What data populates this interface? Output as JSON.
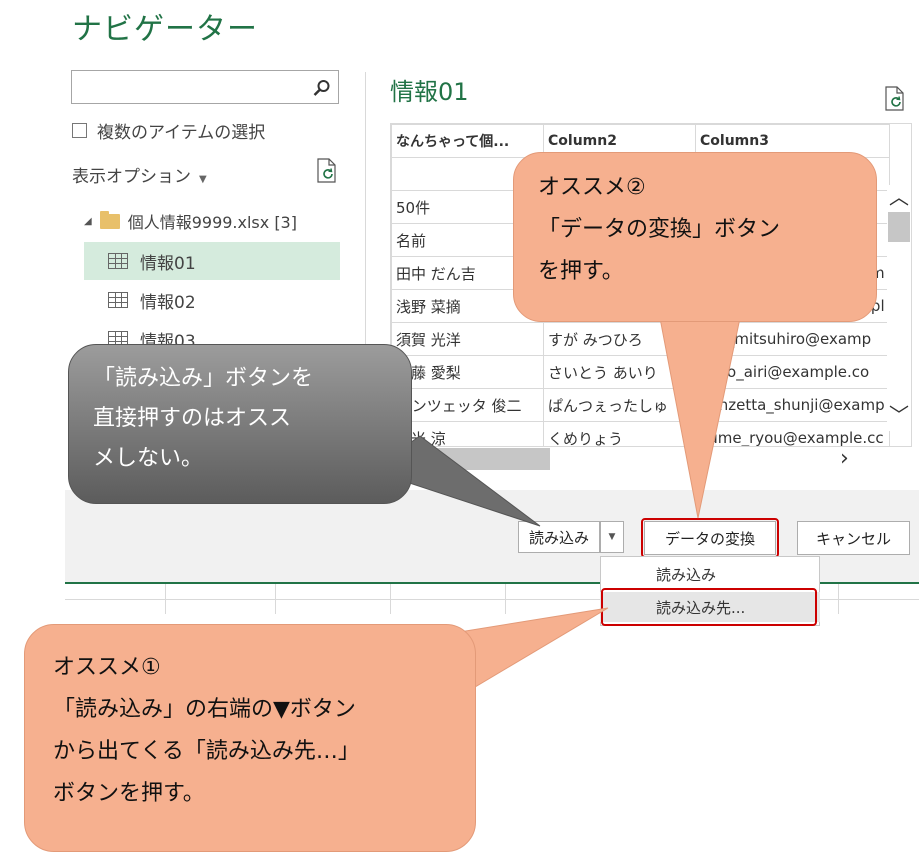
{
  "window": {
    "title": "ナビゲーター"
  },
  "left_pane": {
    "search": {
      "value": "",
      "placeholder": ""
    },
    "multi_select_label": "複数のアイテムの選択",
    "display_options_label": "表示オプション",
    "tree": {
      "root_label": "個人情報9999.xlsx [3]",
      "items": [
        {
          "label": "情報01",
          "selected": true
        },
        {
          "label": "情報02",
          "selected": false
        },
        {
          "label": "情報03",
          "selected": false
        }
      ]
    }
  },
  "preview": {
    "title": "情報01",
    "columns": [
      "なんちゃって個...",
      "Column2",
      "Column3"
    ],
    "rows": [
      [
        "",
        "",
        ""
      ],
      [
        "50件",
        "",
        ""
      ],
      [
        "名前",
        "",
        ""
      ],
      [
        "田中 だん吉",
        "",
        "m"
      ],
      [
        "浅野 菜摘",
        "",
        "pl"
      ],
      [
        "須賀 光洋",
        "すが みつひろ",
        "sug_mitsuhiro@examp"
      ],
      [
        "斎藤 愛梨",
        "さいとう あいり",
        "saito_airi@example.co"
      ],
      [
        "パンツェッタ 俊二",
        "ぱんつぇったしゅ",
        "panzetta_shunji@examp"
      ],
      [
        "久米 涼",
        "くめりょう",
        "kume_ryou@example.cc"
      ]
    ]
  },
  "footer": {
    "load_label": "読み込み",
    "transform_label": "データの変換",
    "cancel_label": "キャンセル",
    "menu_items": [
      "読み込み",
      "読み込み先..."
    ]
  },
  "callouts": {
    "recommend1": [
      "オススメ①",
      "「読み込み」の右端の▼ボタン",
      "から出てくる「読み込み先…」",
      "ボタンを押す。"
    ],
    "recommend2": [
      "オススメ②",
      "「データの変換」ボタン",
      "を押す。"
    ],
    "warning": [
      "「読み込み」ボタンを",
      "直接押すのはオスス",
      "メしない。"
    ]
  },
  "colors": {
    "accent": "#217346",
    "callout": "#f6b08f",
    "highlight_box": "#cc0000"
  }
}
